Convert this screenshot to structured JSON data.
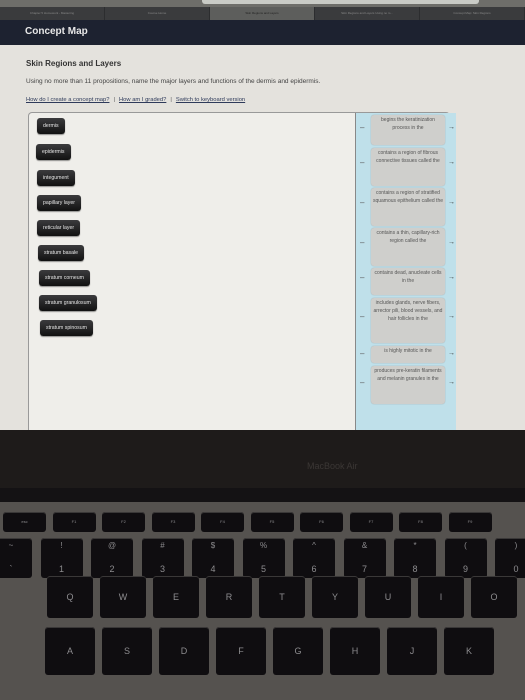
{
  "browser": {
    "tabs": [
      {
        "label": "Chapter 5 Homework - Mastering",
        "active": false
      },
      {
        "label": "Course Home",
        "active": false
      },
      {
        "label": "Skin Regions and Layers",
        "active": true
      },
      {
        "label": "Skin Regions and Layers Using no m...",
        "active": false
      },
      {
        "label": "Concept Map: Skin Regions",
        "active": false
      }
    ]
  },
  "app": {
    "title": "Concept Map"
  },
  "activity": {
    "title": "Skin Regions and Layers",
    "instructions": "Using no more than 11 propositions, name the major layers and functions of the dermis and epidermis.",
    "links": [
      {
        "label": "How do I create a concept map?"
      },
      {
        "label": "How am I graded?"
      },
      {
        "label": "Switch to keyboard version"
      }
    ]
  },
  "concepts": [
    {
      "label": "dermis"
    },
    {
      "label": "epidermis"
    },
    {
      "label": "integument"
    },
    {
      "label": "papillary layer"
    },
    {
      "label": "reticular layer"
    },
    {
      "label": "stratum basale"
    },
    {
      "label": "stratum corneum"
    },
    {
      "label": "stratum granulosum"
    },
    {
      "label": "stratum spinosum"
    }
  ],
  "link_phrases": [
    {
      "label": "begins the keratinization process in the"
    },
    {
      "label": "contains a region of fibrous connective tissues called the"
    },
    {
      "label": "contains a region of stratified squamous epithelium called the"
    },
    {
      "label": "contains a thin, capillary-rich region called the"
    },
    {
      "label": "contains dead, anucleate cells in the"
    },
    {
      "label": "includes glands, nerve fibers, arrector pili, blood vessels, and hair follicles in the"
    },
    {
      "label": "is highly mitotic in the"
    },
    {
      "label": "produces pre-keratin filaments and melanin granules in the"
    }
  ],
  "icons": {
    "dash": "–",
    "arrow": "→"
  },
  "laptop": {
    "brand": "MacBook Air"
  },
  "keyboard": {
    "function_row": [
      "esc",
      "F1",
      "F2",
      "F3",
      "F4",
      "F5",
      "F6",
      "F7",
      "F8",
      "F9"
    ],
    "number_row": [
      {
        "top": "~",
        "bottom": "`"
      },
      {
        "top": "!",
        "bottom": "1"
      },
      {
        "top": "@",
        "bottom": "2"
      },
      {
        "top": "#",
        "bottom": "3"
      },
      {
        "top": "$",
        "bottom": "4"
      },
      {
        "top": "%",
        "bottom": "5"
      },
      {
        "top": "^",
        "bottom": "6"
      },
      {
        "top": "&",
        "bottom": "7"
      },
      {
        "top": "*",
        "bottom": "8"
      },
      {
        "top": "(",
        "bottom": "9"
      },
      {
        "top": ")",
        "bottom": "0"
      }
    ],
    "qwerty_row": [
      "Q",
      "W",
      "E",
      "R",
      "T",
      "Y",
      "U",
      "I",
      "O"
    ],
    "home_row": [
      "A",
      "S",
      "D",
      "F",
      "G",
      "H",
      "J",
      "K"
    ]
  }
}
